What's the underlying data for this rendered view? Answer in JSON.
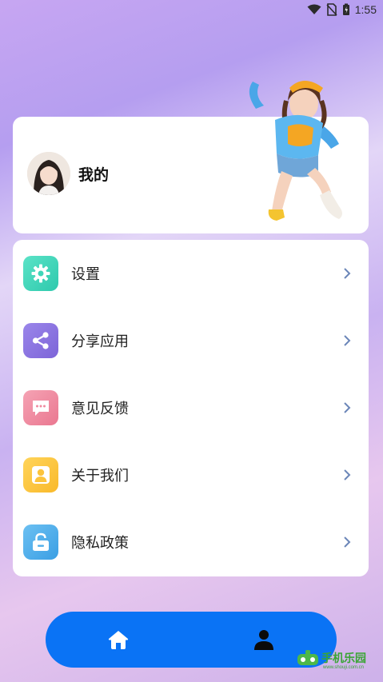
{
  "status_bar": {
    "time": "1:55",
    "icons": [
      "wifi-icon",
      "no-sim-icon",
      "battery-icon"
    ]
  },
  "profile": {
    "name": "我的"
  },
  "menu": {
    "items": [
      {
        "label": "设置",
        "icon": "gear-icon",
        "color": "#3fd6b8"
      },
      {
        "label": "分享应用",
        "icon": "share-icon",
        "color": "#8a72df"
      },
      {
        "label": "意见反馈",
        "icon": "feedback-icon",
        "color": "#f08aa0"
      },
      {
        "label": "关于我们",
        "icon": "user-icon",
        "color": "#fcc43c"
      },
      {
        "label": "隐私政策",
        "icon": "lock-icon",
        "color": "#4faeea"
      }
    ]
  },
  "tab_bar": {
    "color": "#0a73f5",
    "tabs": [
      {
        "icon": "home-icon"
      },
      {
        "icon": "person-icon"
      }
    ]
  },
  "watermark": {
    "text": "手机乐园",
    "url": "www.shouji.com.cn"
  }
}
